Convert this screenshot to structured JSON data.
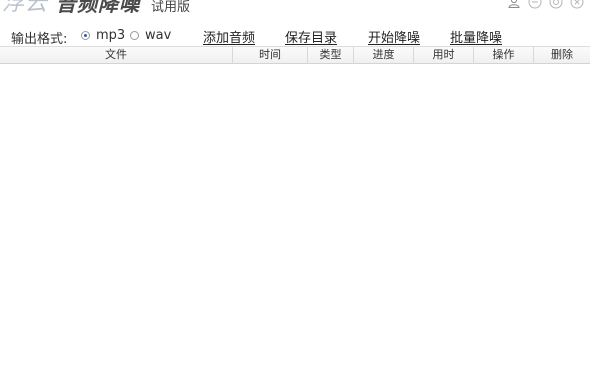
{
  "app": {
    "brand": "浮云",
    "product": "音频降噪",
    "edition": "试用版"
  },
  "window_controls": [
    "user-icon",
    "minimize-icon",
    "settings-icon",
    "close-icon"
  ],
  "toolbar": {
    "format_label": "输出格式:",
    "formats": [
      {
        "label": "mp3",
        "selected": true
      },
      {
        "label": "wav",
        "selected": false
      }
    ],
    "actions": [
      "添加音频",
      "保存目录",
      "开始降噪",
      "批量降噪"
    ]
  },
  "table": {
    "columns": [
      "文件",
      "时间",
      "类型",
      "进度",
      "用时",
      "操作",
      "删除"
    ],
    "rows": []
  },
  "colors": {
    "brand": "#b8c2cc",
    "radio_selected": "#2a5db0",
    "header_bg": "#f0f0f0"
  }
}
